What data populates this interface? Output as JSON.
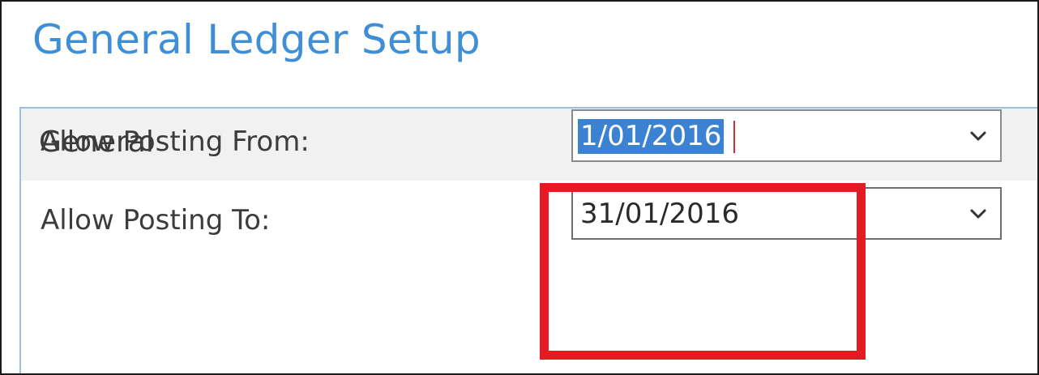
{
  "page": {
    "title": "General Ledger Setup"
  },
  "section": {
    "title": "General"
  },
  "fields": {
    "allow_posting_from": {
      "label": "Allow Posting From:",
      "value": "1/01/2016",
      "selected": true
    },
    "allow_posting_to": {
      "label": "Allow Posting To:",
      "value": "31/01/2016"
    }
  },
  "icons": {
    "dropdown": "chevron-down-icon"
  },
  "colors": {
    "title": "#3f8fd6",
    "selection": "#3b83d2",
    "highlight_box": "#e41b23",
    "panel_header_bg": "#f1f1f1",
    "panel_border": "#9cc0e3"
  }
}
